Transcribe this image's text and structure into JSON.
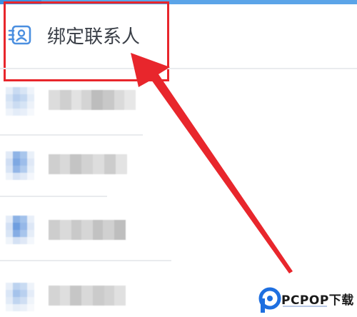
{
  "bind_contacts": {
    "label": "绑定联系人"
  },
  "colors": {
    "accent": "#5ba4e8",
    "highlight": "#e8262c",
    "title_text": "#3a3f47",
    "icon_blue": "#4b8fe0"
  },
  "icons": {
    "contact_card": "contact-card-icon"
  },
  "watermark": {
    "text": "PCPOP下载"
  }
}
